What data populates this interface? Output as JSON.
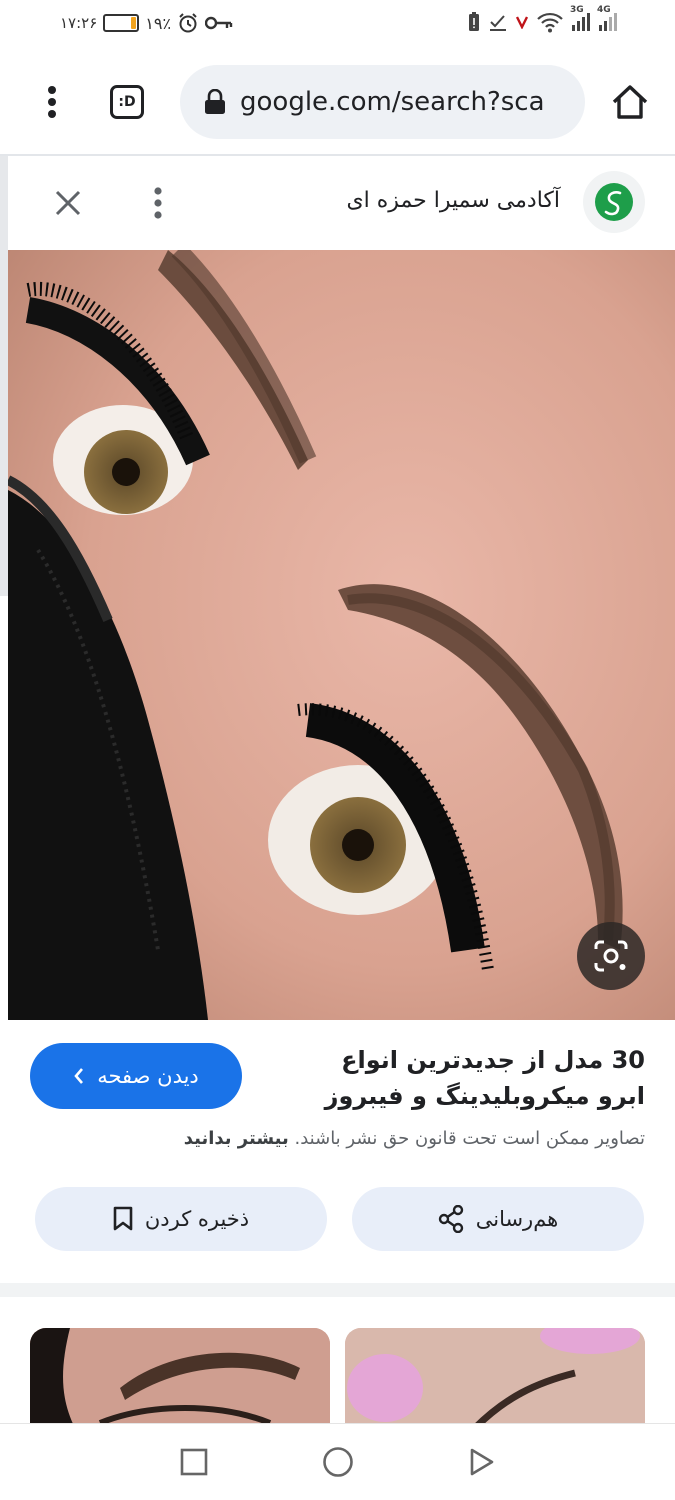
{
  "status_bar": {
    "time": "۱۷:۲۶",
    "battery_percent": "۱۹٪",
    "battery_level": 0.19,
    "right_icons": [
      "battery-saver-icon",
      "check-download-icon",
      "vodafone-icon",
      "wifi-icon",
      "3g-signal-icon",
      "4g-signal-icon"
    ],
    "net_3g": "3G",
    "net_4g": "4G"
  },
  "browser": {
    "tab_icon_label": ":D",
    "url": "google.com/search?sca"
  },
  "panel": {
    "site_name": "آکادمی سمیرا حمزه ای"
  },
  "result": {
    "title": "30 مدل از جدیدترین انواع ابرو میکروبلیدینگ و فیبروز",
    "visit_label": "دیدن صفحه",
    "copyright_text": "تصاویر ممکن است تحت قانون حق نشر باشند.",
    "learn_more": "بیشتر بدانید",
    "share_label": "هم‌رسانی",
    "save_label": "ذخیره کردن"
  },
  "colors": {
    "accent": "#1a73e8",
    "pill_bg": "#e8eef9",
    "logo_green": "#1e9e4a"
  }
}
